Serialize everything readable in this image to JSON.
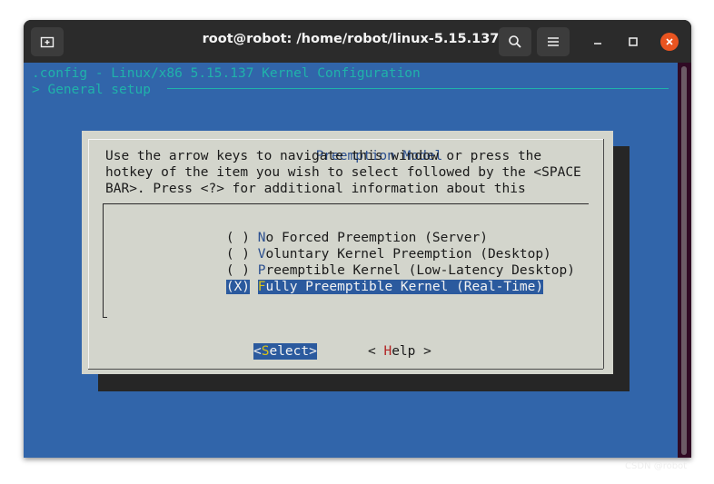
{
  "window": {
    "title": "root@robot: /home/robot/linux-5.15.137"
  },
  "icons": {
    "new_tab": "new-tab-icon",
    "search": "search-icon",
    "menu": "hamburger-menu-icon",
    "minimize": "minimize-icon",
    "maximize": "maximize-icon",
    "close": "close-icon"
  },
  "terminal": {
    "header_line_1": ".config - Linux/x86 5.15.137 Kernel Configuration",
    "header_line_2": "> General setup"
  },
  "dialog": {
    "title": "Preemption Model",
    "help_lines": [
      "Use the arrow keys to navigate this window or press the",
      "hotkey of the item you wish to select followed by the <SPACE",
      "BAR>. Press <?> for additional information about this"
    ],
    "options": [
      {
        "radio": "( )",
        "hotkey": "N",
        "rest": "o Forced Preemption (Server)",
        "selected": false
      },
      {
        "radio": "( )",
        "hotkey": "V",
        "rest": "oluntary Kernel Preemption (Desktop)",
        "selected": false
      },
      {
        "radio": "( )",
        "hotkey": "P",
        "rest": "reemptible Kernel (Low-Latency Desktop)",
        "selected": false
      },
      {
        "radio": "(X)",
        "hotkey": "F",
        "rest": "ully Preemptible Kernel (Real-Time)",
        "selected": true
      }
    ],
    "buttons": {
      "select_pre": "<",
      "select_key": "S",
      "select_rest": "elect>",
      "help_pre": "< ",
      "help_key": "H",
      "help_rest": "elp >"
    }
  },
  "watermark": "CSDN @robot",
  "colors": {
    "terminal_bg": "#3165aa",
    "dialog_bg": "#d3d5cc",
    "header_text": "#20b2aa",
    "highlight": "#2b5a9e",
    "hotkey_selected": "#d9c21a",
    "close_button": "#e95420"
  }
}
